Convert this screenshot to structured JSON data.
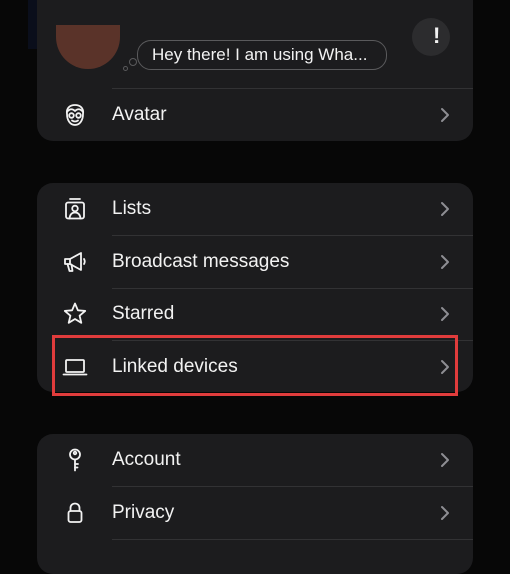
{
  "profile": {
    "status_text": "Hey there! I am using Wha...",
    "corner_button_glyph": "!"
  },
  "menu": {
    "avatar": {
      "label": "Avatar",
      "icon": "avatar-icon"
    },
    "group1": [
      {
        "key": "lists",
        "label": "Lists",
        "icon": "lists-icon"
      },
      {
        "key": "broadcast",
        "label": "Broadcast messages",
        "icon": "megaphone-icon"
      },
      {
        "key": "starred",
        "label": "Starred",
        "icon": "star-icon"
      },
      {
        "key": "linked",
        "label": "Linked devices",
        "icon": "laptop-icon"
      }
    ],
    "group2": [
      {
        "key": "account",
        "label": "Account",
        "icon": "key-icon"
      },
      {
        "key": "privacy",
        "label": "Privacy",
        "icon": "lock-icon"
      }
    ]
  },
  "highlight_color": "#e03c3c"
}
